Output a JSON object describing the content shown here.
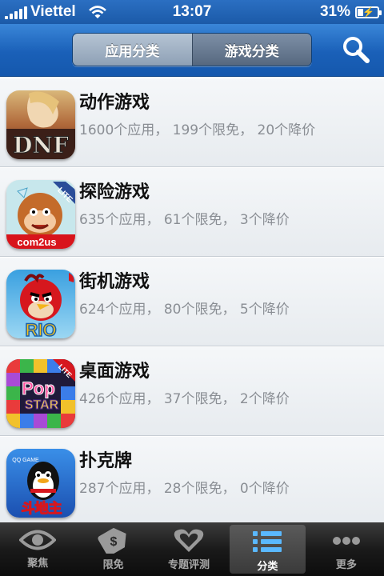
{
  "status_bar": {
    "carrier": "Viettel",
    "time": "13:07",
    "battery_percent": "31%",
    "battery_level": 0.31
  },
  "nav": {
    "segments": [
      {
        "label": "应用分类",
        "selected": true
      },
      {
        "label": "游戏分类",
        "selected": false
      }
    ],
    "search_icon": "search-icon"
  },
  "categories": [
    {
      "title": "动作游戏",
      "subtitle": "1600个应用， 199个限免， 20个降价",
      "icon": "dnf-app-icon"
    },
    {
      "title": "探险游戏",
      "subtitle": "635个应用， 61个限免， 3个降价",
      "icon": "monkey-lite-app-icon"
    },
    {
      "title": "街机游戏",
      "subtitle": "624个应用， 80个限免， 5个降价",
      "icon": "angry-birds-rio-app-icon"
    },
    {
      "title": "桌面游戏",
      "subtitle": "426个应用， 37个限免， 2个降价",
      "icon": "popstar-lite-app-icon"
    },
    {
      "title": "扑克牌",
      "subtitle": "287个应用， 28个限免， 0个降价",
      "icon": "qq-landlord-app-icon"
    }
  ],
  "icon_texts": {
    "dnf": "DNF",
    "lite": "LITE",
    "com2us": "com2us",
    "rio": "RIO",
    "pop": "Pop",
    "star": "STAR",
    "qqgame": "QQ GAME",
    "landlord": "斗地主"
  },
  "tabbar": {
    "tabs": [
      {
        "label": "聚焦",
        "icon": "eye-icon",
        "active": false
      },
      {
        "label": "限免",
        "icon": "price-tag-icon",
        "active": false
      },
      {
        "label": "专题评测",
        "icon": "heart-icon",
        "active": false
      },
      {
        "label": "分类",
        "icon": "list-icon",
        "active": true
      },
      {
        "label": "更多",
        "icon": "more-dots-icon",
        "active": false
      }
    ]
  },
  "colors": {
    "nav_blue": "#1a60b8",
    "row_bg": "#eef1f4",
    "subtitle_gray": "#8a8e94",
    "tabbar_bg": "#1a1a1a"
  }
}
